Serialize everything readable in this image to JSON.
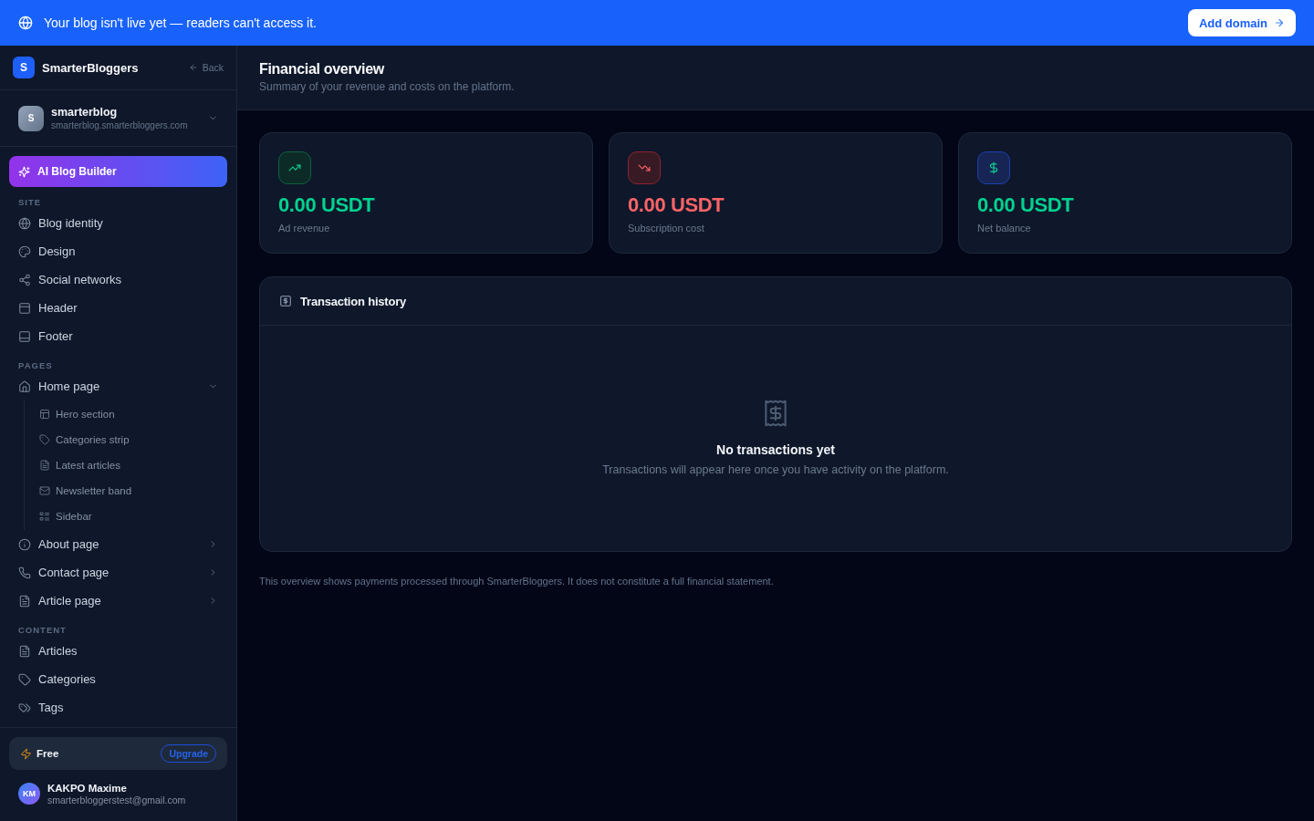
{
  "banner": {
    "text": "Your blog isn't live yet — readers can't access it.",
    "button": "Add domain"
  },
  "sidebar": {
    "brand": {
      "logo": "S",
      "name": "SmarterBloggers",
      "back": "Back"
    },
    "blog": {
      "avatar": "S",
      "name": "smarterblog",
      "url": "smarterblog.smarterbloggers.com"
    },
    "ai_button": "AI Blog Builder",
    "sections": [
      {
        "heading": "SITE",
        "items": [
          {
            "label": "Blog identity"
          },
          {
            "label": "Design"
          },
          {
            "label": "Social networks"
          },
          {
            "label": "Header"
          },
          {
            "label": "Footer"
          }
        ]
      },
      {
        "heading": "PAGES",
        "items": [
          {
            "label": "Home page",
            "expanded": true,
            "children": [
              {
                "label": "Hero section"
              },
              {
                "label": "Categories strip"
              },
              {
                "label": "Latest articles"
              },
              {
                "label": "Newsletter band"
              },
              {
                "label": "Sidebar"
              }
            ]
          },
          {
            "label": "About page",
            "expanded": false
          },
          {
            "label": "Contact page",
            "expanded": false
          },
          {
            "label": "Article page",
            "expanded": false
          }
        ]
      },
      {
        "heading": "CONTENT",
        "items": [
          {
            "label": "Articles"
          },
          {
            "label": "Categories"
          },
          {
            "label": "Tags"
          }
        ]
      }
    ],
    "plan": {
      "name": "Free",
      "button": "Upgrade"
    },
    "user": {
      "initials": "KM",
      "name": "KAKPO Maxime",
      "email": "smarterbloggerstest@gmail.com"
    }
  },
  "main": {
    "header": {
      "title": "Financial overview",
      "subtitle": "Summary of your revenue and costs on the platform."
    },
    "stats": [
      {
        "kind": "revenue",
        "value": "0.00 USDT",
        "label": "Ad revenue"
      },
      {
        "kind": "cost",
        "value": "0.00 USDT",
        "label": "Subscription cost"
      },
      {
        "kind": "balance",
        "value": "0.00 USDT",
        "label": "Net balance"
      }
    ],
    "transactions": {
      "title": "Transaction history",
      "empty_title": "No transactions yet",
      "empty_text": "Transactions will appear here once you have activity on the platform."
    },
    "footnote": "This overview shows payments processed through SmarterBloggers. It does not constitute a full financial statement."
  }
}
